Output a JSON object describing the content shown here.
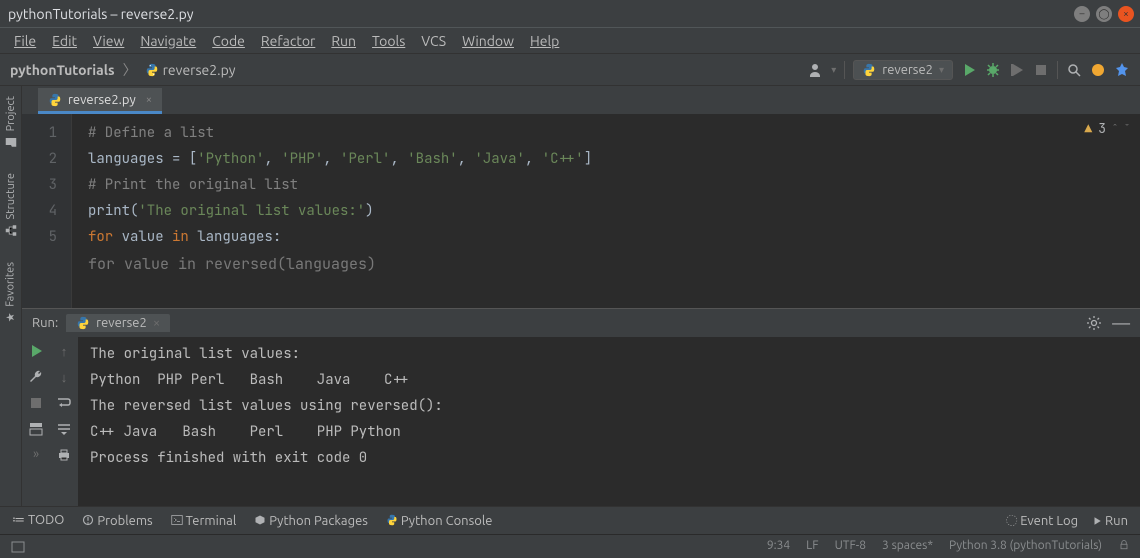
{
  "window": {
    "title": "pythonTutorials – reverse2.py"
  },
  "menu": [
    "File",
    "Edit",
    "View",
    "Navigate",
    "Code",
    "Refactor",
    "Run",
    "Tools",
    "VCS",
    "Window",
    "Help"
  ],
  "breadcrumb": {
    "root": "pythonTutorials",
    "file": "reverse2.py"
  },
  "runconfig": {
    "name": "reverse2"
  },
  "editor": {
    "tab": "reverse2.py",
    "warn_count": "3",
    "lines": {
      "l1": {
        "n": "1",
        "comment": "# Define a list"
      },
      "l2": {
        "n": "2",
        "ident": "languages",
        "eq": " = ",
        "list": "['Python', 'PHP', 'Perl', 'Bash', 'Java', 'C++']"
      },
      "l3": {
        "n": "3",
        "comment": "# Print the original list"
      },
      "l4": {
        "n": "4",
        "fn": "print",
        "str": "'The original list values:'"
      },
      "l5": {
        "n": "5",
        "for": "for",
        "var": "value",
        "in": "in",
        "iter": "languages",
        "colon": ":"
      }
    },
    "hint": "for value in reversed(languages)"
  },
  "run": {
    "label": "Run:",
    "tab": "reverse2",
    "out1": "The original list values:",
    "out2": "Python  PHP Perl   Bash    Java    C++",
    "out3": "The reversed list values using reversed():",
    "out4": "C++ Java   Bash    Perl    PHP Python",
    "out5": "Process finished with exit code 0"
  },
  "bottomTools": {
    "todo": "TODO",
    "problems": "Problems",
    "terminal": "Terminal",
    "packages": "Python Packages",
    "console": "Python Console",
    "eventlog": "Event Log",
    "run": "Run"
  },
  "status": {
    "pos": "9:34",
    "lf": "LF",
    "enc": "UTF-8",
    "indent": "3 spaces*",
    "sdk": "Python 3.8 (pythonTutorials)"
  },
  "rails": {
    "project": "Project",
    "structure": "Structure",
    "favorites": "Favorites"
  }
}
